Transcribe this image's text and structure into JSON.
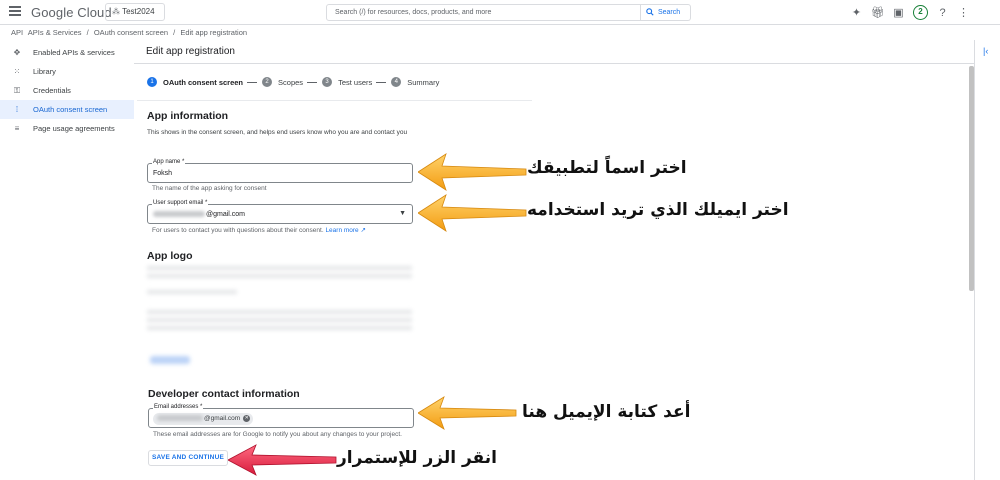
{
  "topbar": {
    "logo": "Google Cloud",
    "project": "Test2024",
    "search_placeholder": "Search (/) for resources, docs, products, and more",
    "search_button": "Search",
    "notif_count": "2",
    "gemini_icon": "sparkle-icon",
    "gift_icon": "gift-icon",
    "terminal_icon": "terminal-icon",
    "help_icon": "help-icon",
    "more_icon": "more-vert-icon"
  },
  "breadcrumb": {
    "section": "APIs & Services",
    "sep1": "/",
    "page": "OAuth consent screen",
    "sep2": "/",
    "current": "Edit app registration"
  },
  "sidebar": {
    "items": [
      {
        "label": "Enabled APIs & services",
        "icon": "api-icon"
      },
      {
        "label": "Library",
        "icon": "library-icon"
      },
      {
        "label": "Credentials",
        "icon": "key-icon"
      },
      {
        "label": "OAuth consent screen",
        "icon": "consent-icon"
      },
      {
        "label": "Page usage agreements",
        "icon": "agreements-icon"
      }
    ]
  },
  "main": {
    "title": "Edit app registration",
    "steps": [
      {
        "num": "1",
        "label": "OAuth consent screen"
      },
      {
        "num": "2",
        "label": "Scopes"
      },
      {
        "num": "3",
        "label": "Test users"
      },
      {
        "num": "4",
        "label": "Summary"
      }
    ],
    "app_info": {
      "title": "App information",
      "desc": "This shows in the consent screen, and helps end users know who you are and contact you",
      "app_name_label": "App name *",
      "app_name_value": "Foksh",
      "app_name_helper": "The name of the app asking for consent",
      "email_label": "User support email *",
      "email_value": "@gmail.com",
      "email_helper": "For users to contact you with questions about their consent.",
      "learn_more": "Learn more"
    },
    "app_logo": {
      "title": "App logo"
    },
    "developer": {
      "title": "Developer contact information",
      "email_label": "Email addresses *",
      "email_chip": "@gmail.com",
      "helper": "These email addresses are for Google to notify you about any changes to your project."
    },
    "save_button": "SAVE AND CONTINUE"
  },
  "annotations": {
    "app_name": "اختر اسماً لتطبيقك",
    "email": "اختر ايميلك الذي تريد استخدامه",
    "developer_email": "أعد كتابة الإيميل هنا",
    "save": "انقر الزر للإستمرار",
    "orange": "#f5a623",
    "red": "#e8364f"
  }
}
